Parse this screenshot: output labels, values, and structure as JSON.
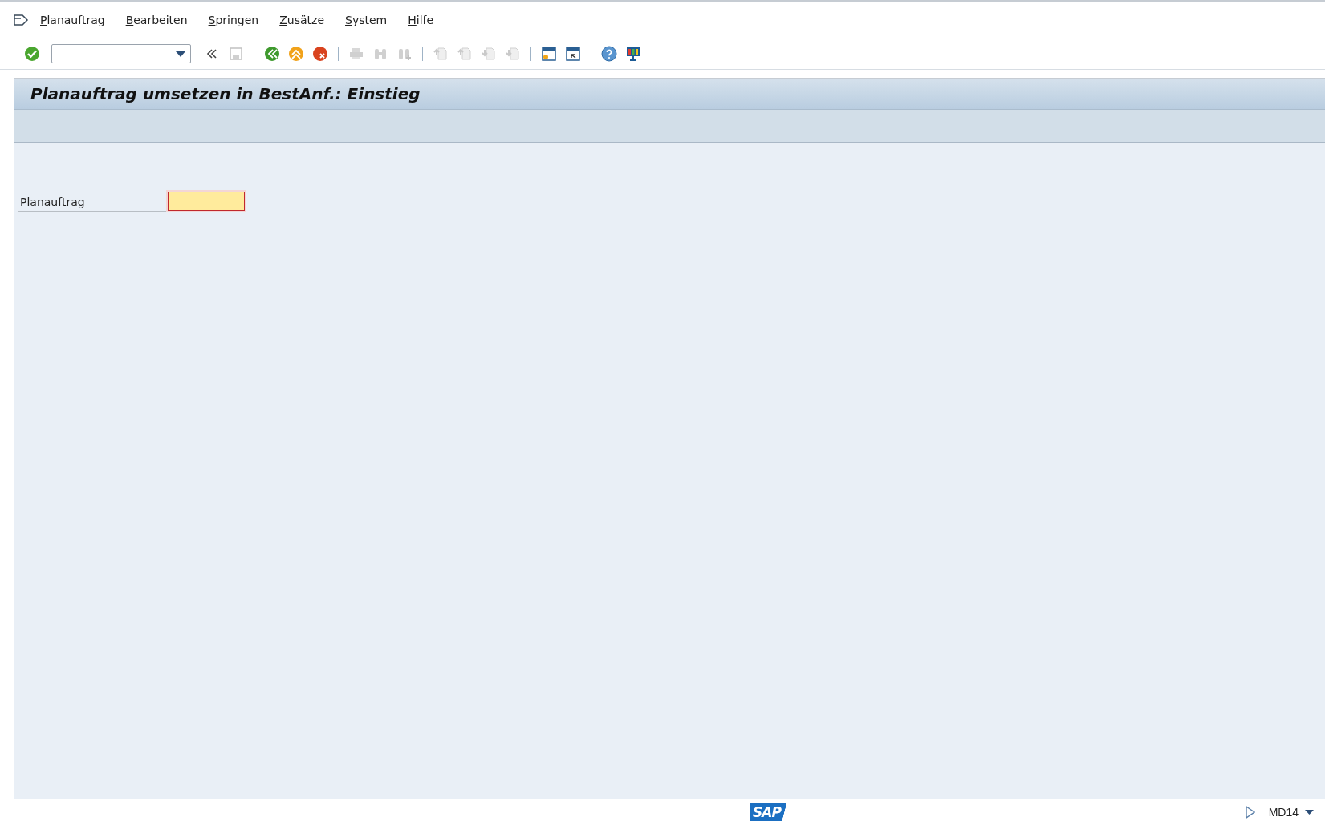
{
  "menu": [
    {
      "label": "Planauftrag"
    },
    {
      "label": "Bearbeiten"
    },
    {
      "label": "Springen"
    },
    {
      "label": "Zusätze"
    },
    {
      "label": "System"
    },
    {
      "label": "Hilfe"
    }
  ],
  "toolbar": [
    {
      "kind": "enter",
      "disabled": false
    },
    {
      "kind": "command",
      "disabled": false
    },
    {
      "kind": "collapse",
      "disabled": false
    },
    {
      "kind": "save",
      "disabled": true
    },
    {
      "kind": "separator"
    },
    {
      "kind": "back",
      "disabled": false
    },
    {
      "kind": "exit",
      "disabled": false
    },
    {
      "kind": "cancel",
      "disabled": false
    },
    {
      "kind": "separator"
    },
    {
      "kind": "print",
      "disabled": true
    },
    {
      "kind": "find",
      "disabled": true
    },
    {
      "kind": "find-next",
      "disabled": true
    },
    {
      "kind": "separator"
    },
    {
      "kind": "first-page",
      "disabled": true
    },
    {
      "kind": "prev-page",
      "disabled": true
    },
    {
      "kind": "next-page",
      "disabled": true
    },
    {
      "kind": "last-page",
      "disabled": true
    },
    {
      "kind": "separator"
    },
    {
      "kind": "new-session",
      "disabled": false
    },
    {
      "kind": "shortcut",
      "disabled": false
    },
    {
      "kind": "separator"
    },
    {
      "kind": "help",
      "disabled": false
    },
    {
      "kind": "layout",
      "disabled": false
    }
  ],
  "title": "Planauftrag umsetzen in BestAnf.: Einstieg",
  "fields": [
    {
      "label": "Planauftrag",
      "required": true
    }
  ],
  "status_bar": {
    "logo": "SAP",
    "transaction": "MD14"
  }
}
